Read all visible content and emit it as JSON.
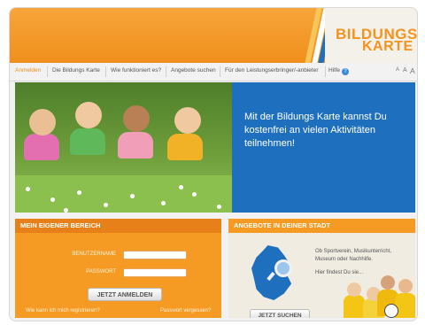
{
  "logo": {
    "line1": "BILDUNGS",
    "line2": "KARTE"
  },
  "nav": {
    "items": [
      {
        "label": "Anmelden",
        "active": true
      },
      {
        "label": "Die Bildungs Karte",
        "active": false
      },
      {
        "label": "Wie funktioniert es?",
        "active": false
      },
      {
        "label": "Angebote suchen",
        "active": false
      },
      {
        "label": "Für den Leistungserbringer/-anbieter",
        "active": false
      },
      {
        "label": "Hilfe",
        "active": false
      }
    ],
    "help_icon": "?",
    "font_sizes": [
      "A",
      "A",
      "A"
    ]
  },
  "hero": {
    "text": "Mit der Bildungs Karte kannst Du kostenfrei an vielen Aktivitäten teilnehmen!",
    "photo": "children-lying-in-grass"
  },
  "login": {
    "title": "MEIN EIGENER BEREICH",
    "username_label": "BENUTZERNAME",
    "password_label": "PASSWORT",
    "username_value": "",
    "password_value": "",
    "submit_label": "JETZT ANMELDEN",
    "register_link": "Wie kann ich mich registrieren?",
    "forgot_link": "Passwort vergessen?"
  },
  "offers": {
    "title": "ANGEBOTE IN DEINER STADT",
    "line1": "Ob Sportverein, Musikunterricht,",
    "line2": "Museum oder Nachhilfe.",
    "line3": "Hier findest Du sie...",
    "button_label": "JETZT SUCHEN",
    "map_icon": "germany-map-magnifier-icon"
  },
  "colors": {
    "orange": "#f59a22",
    "dark_orange": "#e8801a",
    "blue": "#1f6fbf",
    "brand_blue": "#3a8ad8"
  }
}
